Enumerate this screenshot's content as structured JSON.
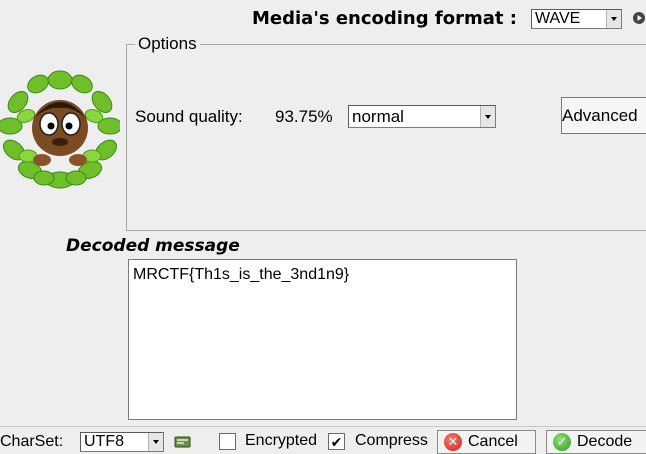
{
  "header": {
    "format_label": "Media's encoding format :",
    "format_value": "WAVE"
  },
  "options": {
    "title": "Options",
    "sound_quality_label": "Sound quality:",
    "sound_quality_value": "93.75%",
    "quality_selected": "normal",
    "advanced_label": "Advanced"
  },
  "decoded": {
    "label": "Decoded message",
    "message": "MRCTF{Th1s_is_the_3nd1n9}"
  },
  "footer": {
    "charset_label": "CharSet:",
    "charset_value": "UTF8",
    "encrypted_label": "Encrypted",
    "encrypted_checked": false,
    "compress_label": "Compress",
    "compress_checked": true,
    "cancel_label": "Cancel",
    "decode_label": "Decode"
  }
}
